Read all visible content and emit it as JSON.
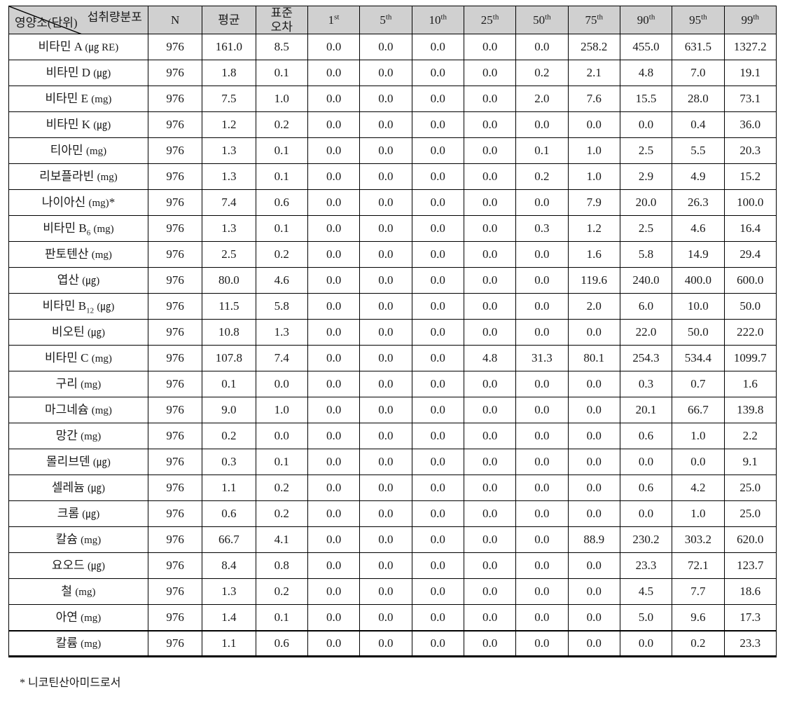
{
  "table": {
    "corner": {
      "top_right_label": "섭취량분포",
      "bottom_left_label": "영양소(단위)"
    },
    "columns": [
      {
        "key": "n",
        "label": "N",
        "sup": ""
      },
      {
        "key": "mean",
        "label": "평균",
        "sup": ""
      },
      {
        "key": "se",
        "label": "표준",
        "label2": "오차",
        "sup": ""
      },
      {
        "key": "p1",
        "label": "1",
        "sup": "st"
      },
      {
        "key": "p5",
        "label": "5",
        "sup": "th"
      },
      {
        "key": "p10",
        "label": "10",
        "sup": "th"
      },
      {
        "key": "p25",
        "label": "25",
        "sup": "th"
      },
      {
        "key": "p50",
        "label": "50",
        "sup": "th"
      },
      {
        "key": "p75",
        "label": "75",
        "sup": "th"
      },
      {
        "key": "p90",
        "label": "90",
        "sup": "th"
      },
      {
        "key": "p95",
        "label": "95",
        "sup": "th"
      },
      {
        "key": "p99",
        "label": "99",
        "sup": "th"
      }
    ],
    "rows": [
      {
        "name": "비타민 A",
        "name_sub": "",
        "unit": "(㎍ RE)",
        "mark": "",
        "values": [
          "976",
          "161.0",
          "8.5",
          "0.0",
          "0.0",
          "0.0",
          "0.0",
          "0.0",
          "258.2",
          "455.0",
          "631.5",
          "1327.2"
        ]
      },
      {
        "name": "비타민 D",
        "name_sub": "",
        "unit": "(㎍)",
        "mark": "",
        "values": [
          "976",
          "1.8",
          "0.1",
          "0.0",
          "0.0",
          "0.0",
          "0.0",
          "0.2",
          "2.1",
          "4.8",
          "7.0",
          "19.1"
        ]
      },
      {
        "name": "비타민 E",
        "name_sub": "",
        "unit": "(mg)",
        "mark": "",
        "values": [
          "976",
          "7.5",
          "1.0",
          "0.0",
          "0.0",
          "0.0",
          "0.0",
          "2.0",
          "7.6",
          "15.5",
          "28.0",
          "73.1"
        ]
      },
      {
        "name": "비타민 K",
        "name_sub": "",
        "unit": "(㎍)",
        "mark": "",
        "values": [
          "976",
          "1.2",
          "0.2",
          "0.0",
          "0.0",
          "0.0",
          "0.0",
          "0.0",
          "0.0",
          "0.0",
          "0.4",
          "36.0"
        ]
      },
      {
        "name": "티아민",
        "name_sub": "",
        "unit": "(mg)",
        "mark": "",
        "values": [
          "976",
          "1.3",
          "0.1",
          "0.0",
          "0.0",
          "0.0",
          "0.0",
          "0.1",
          "1.0",
          "2.5",
          "5.5",
          "20.3"
        ]
      },
      {
        "name": "리보플라빈",
        "name_sub": "",
        "unit": "(mg)",
        "mark": "",
        "values": [
          "976",
          "1.3",
          "0.1",
          "0.0",
          "0.0",
          "0.0",
          "0.0",
          "0.2",
          "1.0",
          "2.9",
          "4.9",
          "15.2"
        ]
      },
      {
        "name": "나이아신",
        "name_sub": "",
        "unit": "(mg)",
        "mark": "*",
        "values": [
          "976",
          "7.4",
          "0.6",
          "0.0",
          "0.0",
          "0.0",
          "0.0",
          "0.0",
          "7.9",
          "20.0",
          "26.3",
          "100.0"
        ]
      },
      {
        "name": "비타민 B",
        "name_sub": "6",
        "unit": "(mg)",
        "mark": "",
        "values": [
          "976",
          "1.3",
          "0.1",
          "0.0",
          "0.0",
          "0.0",
          "0.0",
          "0.3",
          "1.2",
          "2.5",
          "4.6",
          "16.4"
        ]
      },
      {
        "name": "판토텐산",
        "name_sub": "",
        "unit": "(mg)",
        "mark": "",
        "values": [
          "976",
          "2.5",
          "0.2",
          "0.0",
          "0.0",
          "0.0",
          "0.0",
          "0.0",
          "1.6",
          "5.8",
          "14.9",
          "29.4"
        ]
      },
      {
        "name": "엽산",
        "name_sub": "",
        "unit": "(㎍)",
        "mark": "",
        "values": [
          "976",
          "80.0",
          "4.6",
          "0.0",
          "0.0",
          "0.0",
          "0.0",
          "0.0",
          "119.6",
          "240.0",
          "400.0",
          "600.0"
        ]
      },
      {
        "name": "비타민 B",
        "name_sub": "12",
        "unit": "(㎍)",
        "mark": "",
        "values": [
          "976",
          "11.5",
          "5.8",
          "0.0",
          "0.0",
          "0.0",
          "0.0",
          "0.0",
          "2.0",
          "6.0",
          "10.0",
          "50.0"
        ]
      },
      {
        "name": "비오틴",
        "name_sub": "",
        "unit": "(㎍)",
        "mark": "",
        "values": [
          "976",
          "10.8",
          "1.3",
          "0.0",
          "0.0",
          "0.0",
          "0.0",
          "0.0",
          "0.0",
          "22.0",
          "50.0",
          "222.0"
        ]
      },
      {
        "name": "비타민 C",
        "name_sub": "",
        "unit": "(mg)",
        "mark": "",
        "values": [
          "976",
          "107.8",
          "7.4",
          "0.0",
          "0.0",
          "0.0",
          "4.8",
          "31.3",
          "80.1",
          "254.3",
          "534.4",
          "1099.7"
        ]
      },
      {
        "name": "구리",
        "name_sub": "",
        "unit": "(mg)",
        "mark": "",
        "values": [
          "976",
          "0.1",
          "0.0",
          "0.0",
          "0.0",
          "0.0",
          "0.0",
          "0.0",
          "0.0",
          "0.3",
          "0.7",
          "1.6"
        ]
      },
      {
        "name": "마그네슘",
        "name_sub": "",
        "unit": "(mg)",
        "mark": "",
        "values": [
          "976",
          "9.0",
          "1.0",
          "0.0",
          "0.0",
          "0.0",
          "0.0",
          "0.0",
          "0.0",
          "20.1",
          "66.7",
          "139.8"
        ]
      },
      {
        "name": "망간",
        "name_sub": "",
        "unit": "(mg)",
        "mark": "",
        "values": [
          "976",
          "0.2",
          "0.0",
          "0.0",
          "0.0",
          "0.0",
          "0.0",
          "0.0",
          "0.0",
          "0.6",
          "1.0",
          "2.2"
        ]
      },
      {
        "name": "몰리브덴",
        "name_sub": "",
        "unit": "(㎍)",
        "mark": "",
        "values": [
          "976",
          "0.3",
          "0.1",
          "0.0",
          "0.0",
          "0.0",
          "0.0",
          "0.0",
          "0.0",
          "0.0",
          "0.0",
          "9.1"
        ]
      },
      {
        "name": "셀레늄",
        "name_sub": "",
        "unit": "(㎍)",
        "mark": "",
        "values": [
          "976",
          "1.1",
          "0.2",
          "0.0",
          "0.0",
          "0.0",
          "0.0",
          "0.0",
          "0.0",
          "0.6",
          "4.2",
          "25.0"
        ]
      },
      {
        "name": "크롬",
        "name_sub": "",
        "unit": "(㎍)",
        "mark": "",
        "values": [
          "976",
          "0.6",
          "0.2",
          "0.0",
          "0.0",
          "0.0",
          "0.0",
          "0.0",
          "0.0",
          "0.0",
          "1.0",
          "25.0"
        ]
      },
      {
        "name": "칼슘",
        "name_sub": "",
        "unit": "(mg)",
        "mark": "",
        "values": [
          "976",
          "66.7",
          "4.1",
          "0.0",
          "0.0",
          "0.0",
          "0.0",
          "0.0",
          "88.9",
          "230.2",
          "303.2",
          "620.0"
        ]
      },
      {
        "name": "요오드",
        "name_sub": "",
        "unit": "(㎍)",
        "mark": "",
        "values": [
          "976",
          "8.4",
          "0.8",
          "0.0",
          "0.0",
          "0.0",
          "0.0",
          "0.0",
          "0.0",
          "23.3",
          "72.1",
          "123.7"
        ]
      },
      {
        "name": "철",
        "name_sub": "",
        "unit": "(mg)",
        "mark": "",
        "values": [
          "976",
          "1.3",
          "0.2",
          "0.0",
          "0.0",
          "0.0",
          "0.0",
          "0.0",
          "0.0",
          "4.5",
          "7.7",
          "18.6"
        ]
      },
      {
        "name": "아연",
        "name_sub": "",
        "unit": "(mg)",
        "mark": "",
        "values": [
          "976",
          "1.4",
          "0.1",
          "0.0",
          "0.0",
          "0.0",
          "0.0",
          "0.0",
          "0.0",
          "5.0",
          "9.6",
          "17.3"
        ]
      },
      {
        "name": "칼륨",
        "name_sub": "",
        "unit": "(mg)",
        "mark": "",
        "values": [
          "976",
          "1.1",
          "0.6",
          "0.0",
          "0.0",
          "0.0",
          "0.0",
          "0.0",
          "0.0",
          "0.0",
          "0.2",
          "23.3"
        ]
      }
    ]
  },
  "footnote": "* 니코틴산아미드로서",
  "colors": {
    "header_background": "#d0d0d0",
    "border": "#000000",
    "text": "#1a1a1a",
    "cell_background": "#ffffff"
  }
}
